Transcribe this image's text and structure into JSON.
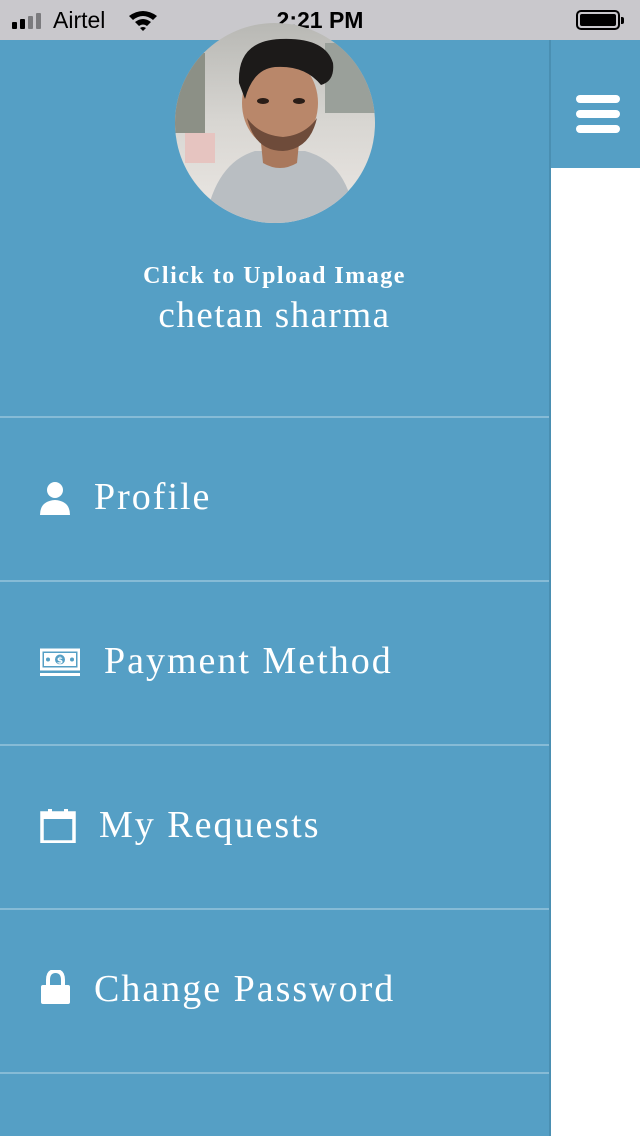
{
  "status_bar": {
    "carrier": "Airtel",
    "time": "2:21 PM",
    "icons": [
      "signal-icon",
      "wifi-icon",
      "battery-icon"
    ]
  },
  "drawer": {
    "background": "#559fc5",
    "upload_label": "Click to Upload Image",
    "user_name": "chetan sharma",
    "menu": [
      {
        "label": "Profile",
        "icon": "user-icon"
      },
      {
        "label": "Payment Method",
        "icon": "money-icon"
      },
      {
        "label": "My Requests",
        "icon": "calendar-icon"
      },
      {
        "label": "Change Password",
        "icon": "lock-icon"
      }
    ]
  },
  "header": {
    "menu_toggle_icon": "hamburger-icon"
  }
}
